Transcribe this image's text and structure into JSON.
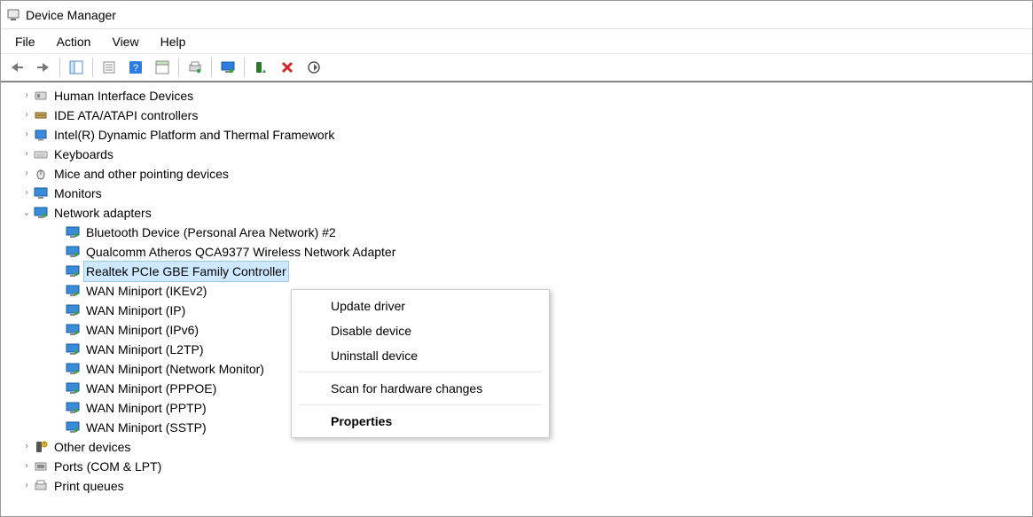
{
  "window": {
    "title": "Device Manager"
  },
  "menu": {
    "file": "File",
    "action": "Action",
    "view": "View",
    "help": "Help"
  },
  "toolbar_icons": {
    "back": "back-arrow-icon",
    "forward": "forward-arrow-icon",
    "showhide": "show-hide-tree-icon",
    "props": "properties-icon",
    "help": "help-icon",
    "action": "action-center-icon",
    "print": "print-icon",
    "monitor": "monitor-icon",
    "enable": "enable-device-icon",
    "disable": "disable-device-icon",
    "scan": "scan-hardware-icon"
  },
  "tree": {
    "nodes": [
      {
        "label": "Human Interface Devices",
        "icon": "hid-icon",
        "expanded": false
      },
      {
        "label": "IDE ATA/ATAPI controllers",
        "icon": "ide-icon",
        "expanded": false
      },
      {
        "label": "Intel(R) Dynamic Platform and Thermal Framework",
        "icon": "platform-icon",
        "expanded": false
      },
      {
        "label": "Keyboards",
        "icon": "keyboard-icon",
        "expanded": false
      },
      {
        "label": "Mice and other pointing devices",
        "icon": "mouse-icon",
        "expanded": false
      },
      {
        "label": "Monitors",
        "icon": "monitor-category-icon",
        "expanded": false
      },
      {
        "label": "Network adapters",
        "icon": "network-adapter-icon",
        "expanded": true
      }
    ],
    "network_children": [
      {
        "label": "Bluetooth Device (Personal Area Network) #2",
        "selected": false
      },
      {
        "label": "Qualcomm Atheros QCA9377 Wireless Network Adapter",
        "selected": false
      },
      {
        "label": "Realtek PCIe GBE Family Controller",
        "selected": true
      },
      {
        "label": "WAN Miniport (IKEv2)",
        "selected": false
      },
      {
        "label": "WAN Miniport (IP)",
        "selected": false
      },
      {
        "label": "WAN Miniport (IPv6)",
        "selected": false
      },
      {
        "label": "WAN Miniport (L2TP)",
        "selected": false
      },
      {
        "label": "WAN Miniport (Network Monitor)",
        "selected": false
      },
      {
        "label": "WAN Miniport (PPPOE)",
        "selected": false
      },
      {
        "label": "WAN Miniport (PPTP)",
        "selected": false
      },
      {
        "label": "WAN Miniport (SSTP)",
        "selected": false
      }
    ],
    "after": [
      {
        "label": "Other devices",
        "icon": "other-devices-icon",
        "expanded": false
      },
      {
        "label": "Ports (COM & LPT)",
        "icon": "ports-icon",
        "expanded": false
      },
      {
        "label": "Print queues",
        "icon": "print-queue-icon",
        "expanded": false
      }
    ]
  },
  "context_menu": {
    "update": "Update driver",
    "disable": "Disable device",
    "uninstall": "Uninstall device",
    "scan": "Scan for hardware changes",
    "properties": "Properties"
  }
}
